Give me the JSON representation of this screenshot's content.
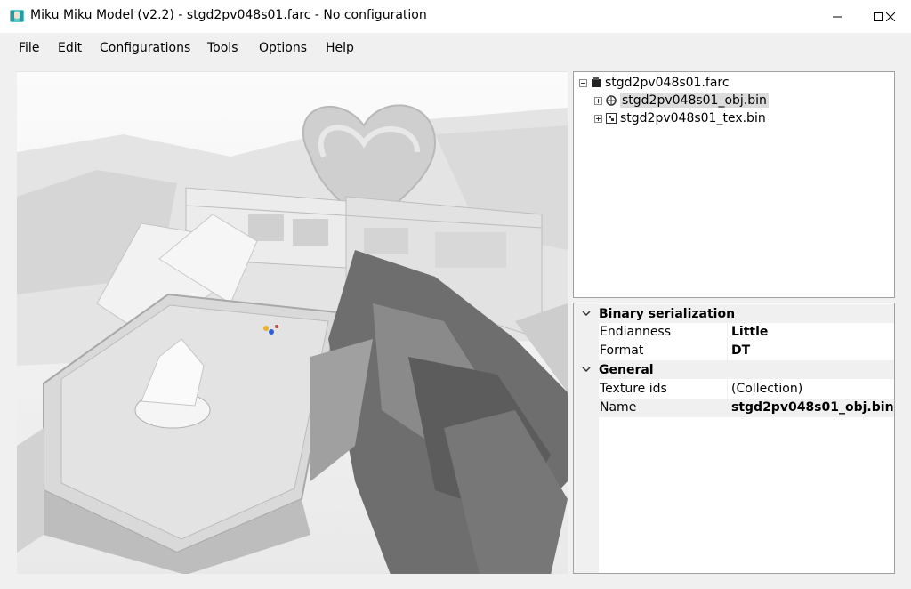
{
  "window": {
    "title": "Miku Miku Model (v2.2) - stgd2pv048s01.farc - No configuration",
    "icon": "miku-app-icon",
    "controls": [
      "minimize-icon",
      "maximize-icon",
      "close-icon"
    ]
  },
  "menu": {
    "items": [
      "File",
      "Edit",
      "Configurations",
      "Tools",
      "Options",
      "Help"
    ]
  },
  "tree": {
    "root": {
      "label": "stgd2pv048s01.farc",
      "icon": "archive-icon",
      "expanded": true
    },
    "children": [
      {
        "label": "stgd2pv048s01_obj.bin",
        "icon": "object-set-icon",
        "expanded": false,
        "selected": true
      },
      {
        "label": "stgd2pv048s01_tex.bin",
        "icon": "texture-set-icon",
        "expanded": false,
        "selected": false
      }
    ]
  },
  "properties": {
    "categories": [
      {
        "name": "Binary serialization",
        "rows": [
          {
            "key": "Endianness",
            "value": "Little",
            "bold": true
          },
          {
            "key": "Format",
            "value": "DT",
            "bold": true
          }
        ]
      },
      {
        "name": "General",
        "rows": [
          {
            "key": "Texture ids",
            "value": "(Collection)",
            "bold": false
          },
          {
            "key": "Name",
            "value": "stgd2pv048s01_obj.bin",
            "bold": true
          }
        ]
      }
    ]
  },
  "viewport": {
    "description_icon": "3d-model-viewport"
  }
}
